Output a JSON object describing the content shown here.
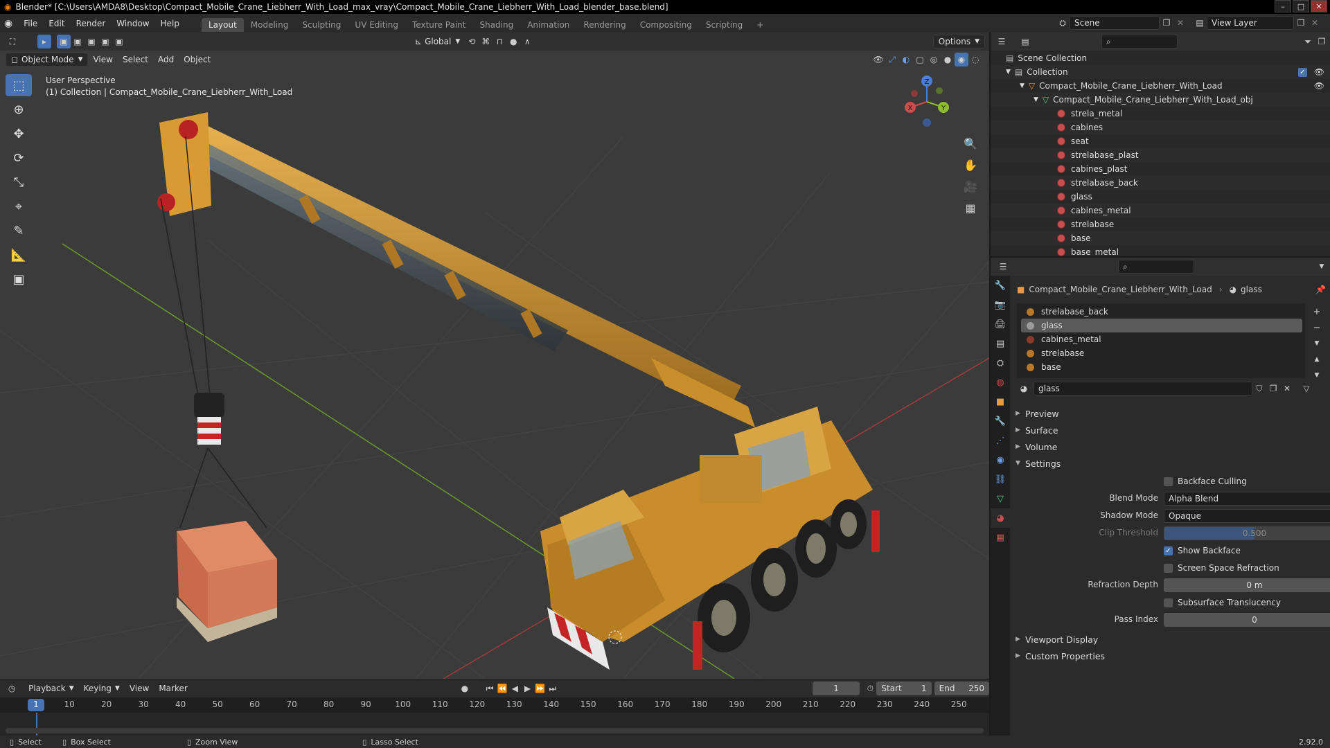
{
  "window": {
    "title": "Blender* [C:\\Users\\AMDA8\\Desktop\\Compact_Mobile_Crane_Liebherr_With_Load_max_vray\\Compact_Mobile_Crane_Liebherr_With_Load_blender_base.blend]"
  },
  "menubar": {
    "menus": [
      "File",
      "Edit",
      "Render",
      "Window",
      "Help"
    ],
    "workspaces": [
      "Layout",
      "Modeling",
      "Sculpting",
      "UV Editing",
      "Texture Paint",
      "Shading",
      "Animation",
      "Rendering",
      "Compositing",
      "Scripting"
    ],
    "active_workspace": "Layout",
    "scene": "Scene",
    "view_layer": "View Layer"
  },
  "viewport": {
    "mode": "Object Mode",
    "menus": [
      "View",
      "Select",
      "Add",
      "Object"
    ],
    "orientation": "Global",
    "options": "Options",
    "perspective": "User Perspective",
    "collection_info": "(1) Collection | Compact_Mobile_Crane_Liebherr_With_Load",
    "gizmo": {
      "x": "X",
      "y": "Y",
      "z": "Z"
    }
  },
  "timeline": {
    "menus": [
      "Playback",
      "Keying",
      "View",
      "Marker"
    ],
    "current_frame": "1",
    "start_label": "Start",
    "start": "1",
    "end_label": "End",
    "end": "250",
    "ticks": [
      "1",
      "10",
      "20",
      "30",
      "40",
      "50",
      "60",
      "70",
      "80",
      "90",
      "100",
      "110",
      "120",
      "130",
      "140",
      "150",
      "160",
      "170",
      "180",
      "190",
      "200",
      "210",
      "220",
      "230",
      "240",
      "250"
    ]
  },
  "statusbar": {
    "items": [
      "Select",
      "Box Select",
      "Zoom View",
      "Lasso Select"
    ],
    "version": "2.92.0"
  },
  "outliner": {
    "scene_collection": "Scene Collection",
    "collection": "Collection",
    "object": "Compact_Mobile_Crane_Liebherr_With_Load",
    "mesh": "Compact_Mobile_Crane_Liebherr_With_Load_obj",
    "materials": [
      "strela_metal",
      "cabines",
      "seat",
      "strelabase_plast",
      "cabines_plast",
      "strelabase_back",
      "glass",
      "cabines_metal",
      "strelabase",
      "base",
      "base_metal"
    ]
  },
  "properties": {
    "breadcrumb_object": "Compact_Mobile_Crane_Liebherr_With_Load",
    "breadcrumb_material": "glass",
    "slots": [
      "strelabase_back",
      "glass",
      "cabines_metal",
      "strelabase",
      "base"
    ],
    "active_slot": "glass",
    "material_name": "glass",
    "panels": {
      "preview": "Preview",
      "surface": "Surface",
      "volume": "Volume",
      "settings": "Settings",
      "viewport_display": "Viewport Display",
      "custom_properties": "Custom Properties"
    },
    "settings": {
      "backface_culling": "Backface Culling",
      "blend_mode_label": "Blend Mode",
      "blend_mode": "Alpha Blend",
      "shadow_mode_label": "Shadow Mode",
      "shadow_mode": "Opaque",
      "clip_threshold_label": "Clip Threshold",
      "clip_threshold": "0.500",
      "show_backface": "Show Backface",
      "screen_space_refraction": "Screen Space Refraction",
      "refraction_depth_label": "Refraction Depth",
      "refraction_depth": "0 m",
      "subsurface_translucency": "Subsurface Translucency",
      "pass_index_label": "Pass Index",
      "pass_index": "0"
    }
  },
  "colors": {
    "accent": "#4772b3",
    "crane_yellow": "#d49a2e",
    "material_icon": "#c84f4f"
  }
}
